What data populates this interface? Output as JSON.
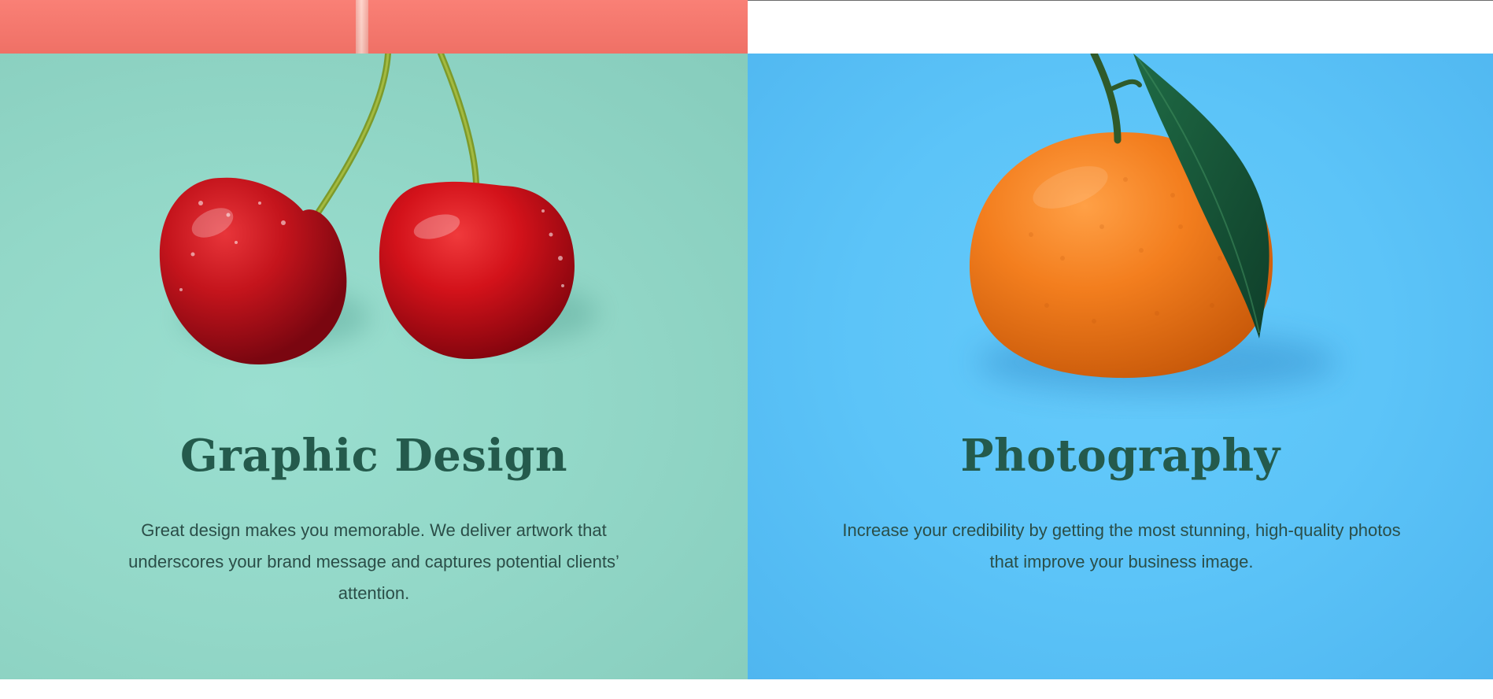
{
  "services": [
    {
      "title": "Graphic Design",
      "description": "Great design makes you memorable. We deliver artwork that underscores your brand message and captures potential clients’ attention.",
      "image": "cherries-photo",
      "background_color": "#93d8c8"
    },
    {
      "title": "Photography",
      "description": "Increase your credibility by getting the most stunning, high-quality photos that improve your business image.",
      "image": "orange-photo",
      "background_color": "#5cc4f8"
    }
  ],
  "colors": {
    "heading": "#245a4c",
    "body_text": "#2b4e48",
    "top_strip": "#f9756a"
  }
}
